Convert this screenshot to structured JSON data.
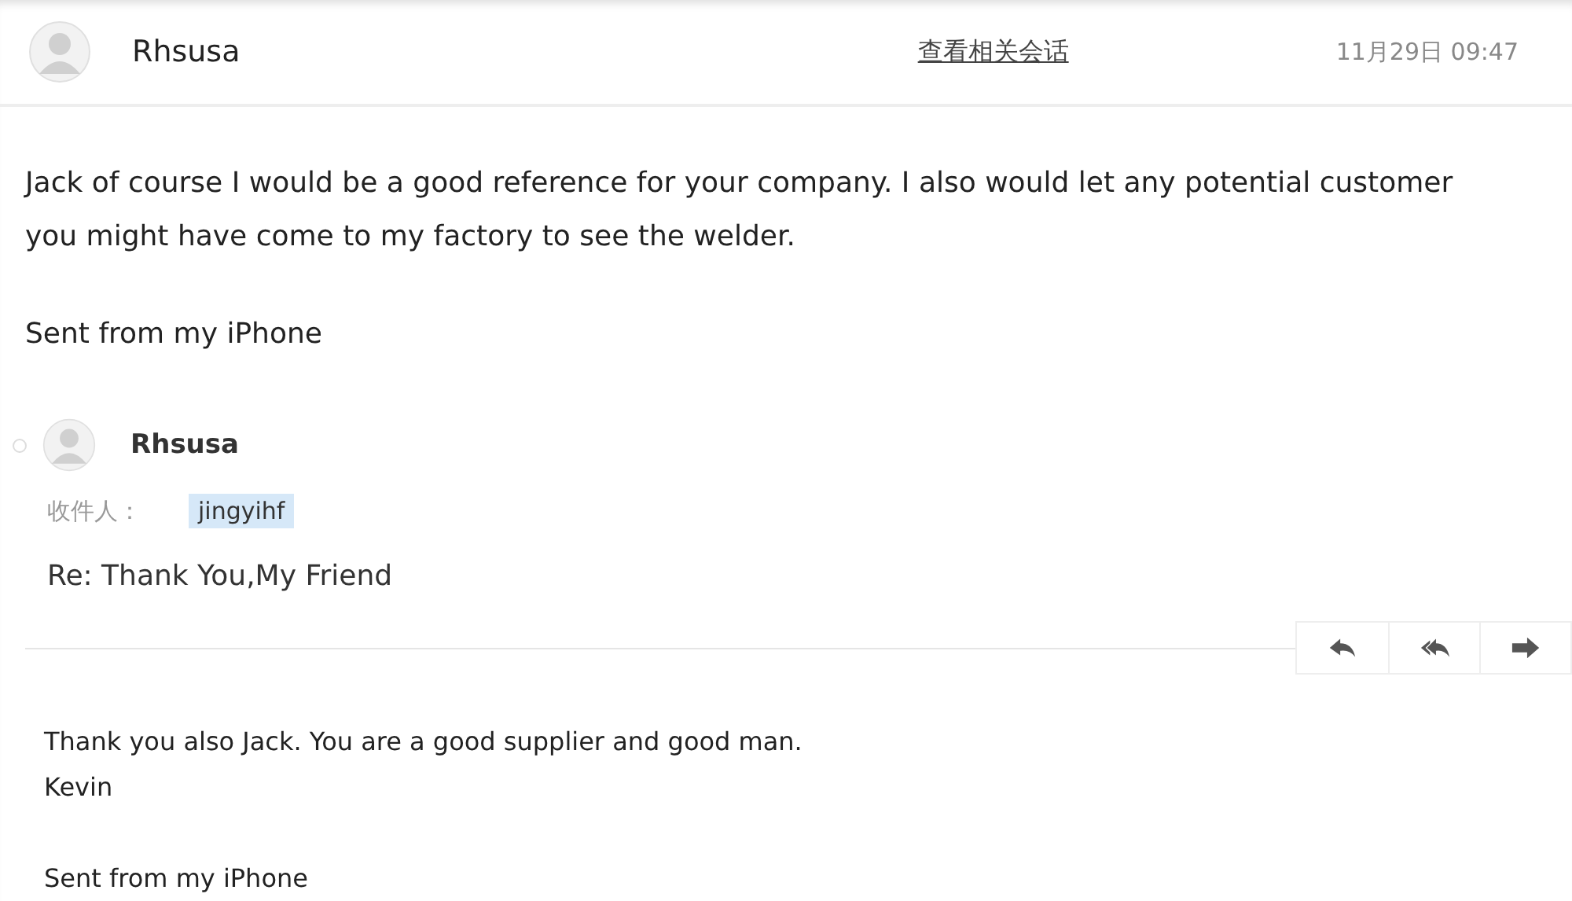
{
  "header": {
    "sender": "Rhsusa",
    "conversation_link": "查看相关会话",
    "time": "11月29日 09:47"
  },
  "body": [
    "Jack of course I would be a good reference for your company. I also would let any potential customer you might have come to my factory to see the welder.",
    "Sent from my iPhone"
  ],
  "quoted": {
    "sender": "Rhsusa",
    "recipient_label": "收件人：",
    "recipients": [
      "jingyihf"
    ],
    "subject": "Re: Thank You,My Friend",
    "actions": [
      {
        "kind": "reply"
      },
      {
        "kind": "reply-all"
      },
      {
        "kind": "forward"
      }
    ],
    "body": [
      [
        "Thank you also Jack. You are a good supplier and good man.",
        "Kevin"
      ],
      [
        "Sent from my iPhone"
      ]
    ]
  }
}
